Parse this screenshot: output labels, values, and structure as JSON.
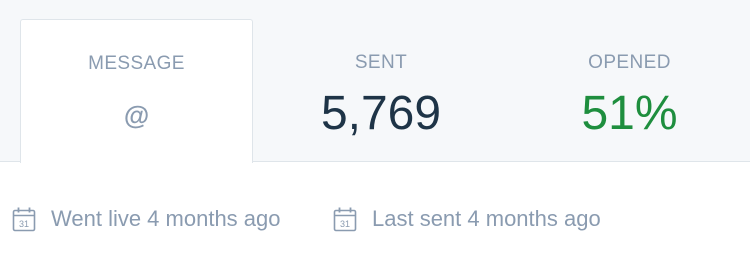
{
  "tabs": {
    "message": {
      "label": "MESSAGE",
      "icon": "at-icon",
      "icon_glyph": "@"
    },
    "sent": {
      "label": "SENT",
      "value": "5,769"
    },
    "opened": {
      "label": "OPENED",
      "value": "51%"
    }
  },
  "meta": {
    "went_live": "Went live 4 months ago",
    "last_sent": "Last sent 4 months ago",
    "icon": "calendar-icon"
  },
  "colors": {
    "label": "#8a9bb0",
    "value": "#1e3447",
    "opened_value": "#1e8e3e",
    "bar_background": "#f6f8fa",
    "border": "#dfe5ea"
  }
}
